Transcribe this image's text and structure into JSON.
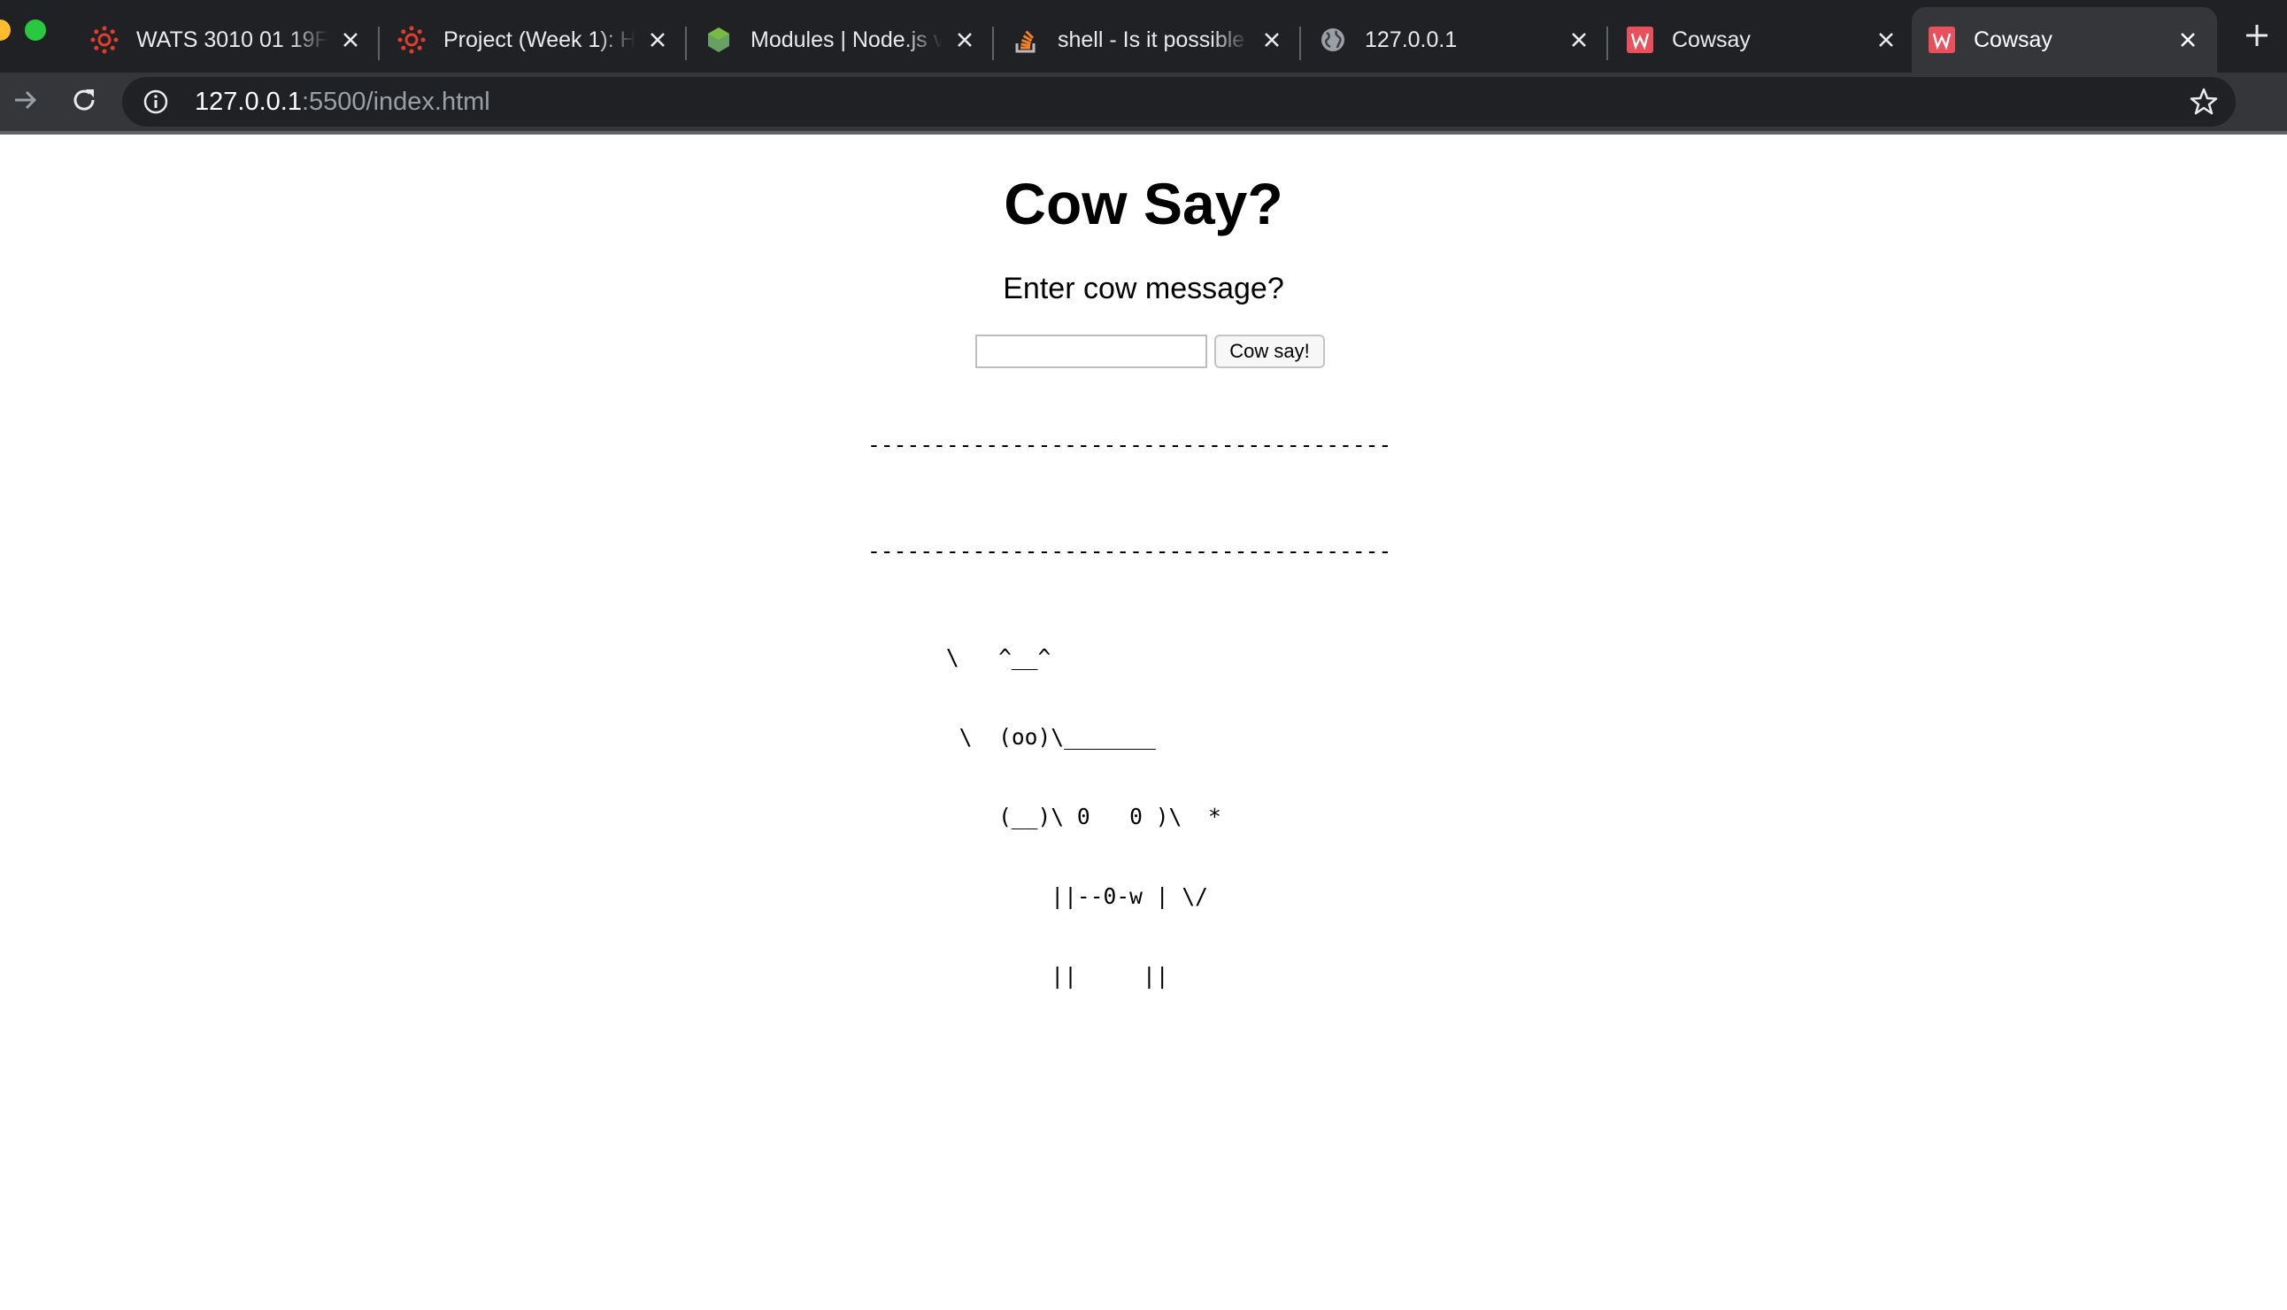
{
  "browser": {
    "tabs": [
      {
        "title": "WATS 3010 01 19FC",
        "favicon": "canvas-logo-icon",
        "active": false
      },
      {
        "title": "Project (Week 1): H",
        "favicon": "canvas-logo-icon",
        "active": false
      },
      {
        "title": "Modules | Node.js v",
        "favicon": "nodejs-logo-icon",
        "active": false
      },
      {
        "title": "shell - Is it possible",
        "favicon": "stackoverflow-icon",
        "active": false
      },
      {
        "title": "127.0.0.1",
        "favicon": "globe-icon",
        "active": false
      },
      {
        "title": "Cowsay",
        "favicon": "w-logo-icon",
        "active": false
      },
      {
        "title": "Cowsay",
        "favicon": "w-logo-icon",
        "active": true
      }
    ],
    "address": {
      "host": "127.0.0.1",
      "rest": ":5500/index.html"
    }
  },
  "page": {
    "heading": "Cow Say?",
    "prompt": "Enter cow message?",
    "input_value": "",
    "button_label": "Cow say!",
    "output": {
      "top_rule": "----------------------------------------",
      "message": "",
      "bottom_rule": "----------------------------------------",
      "cow_lines": [
        "      \\   ^__^",
        "       \\  (oo)\\_______",
        "          (__)\\ 0   0 )\\  *",
        "              ||--0-w | \\/",
        "              ||     ||"
      ]
    }
  },
  "colors": {
    "chrome_dark": "#202124",
    "chrome_toolbar": "#35363a",
    "tab_text": "#e8eaed",
    "canvas_red": "#e03e2d",
    "node_green": "#68a063",
    "so_orange": "#f48024",
    "w_red": "#e8505b"
  }
}
